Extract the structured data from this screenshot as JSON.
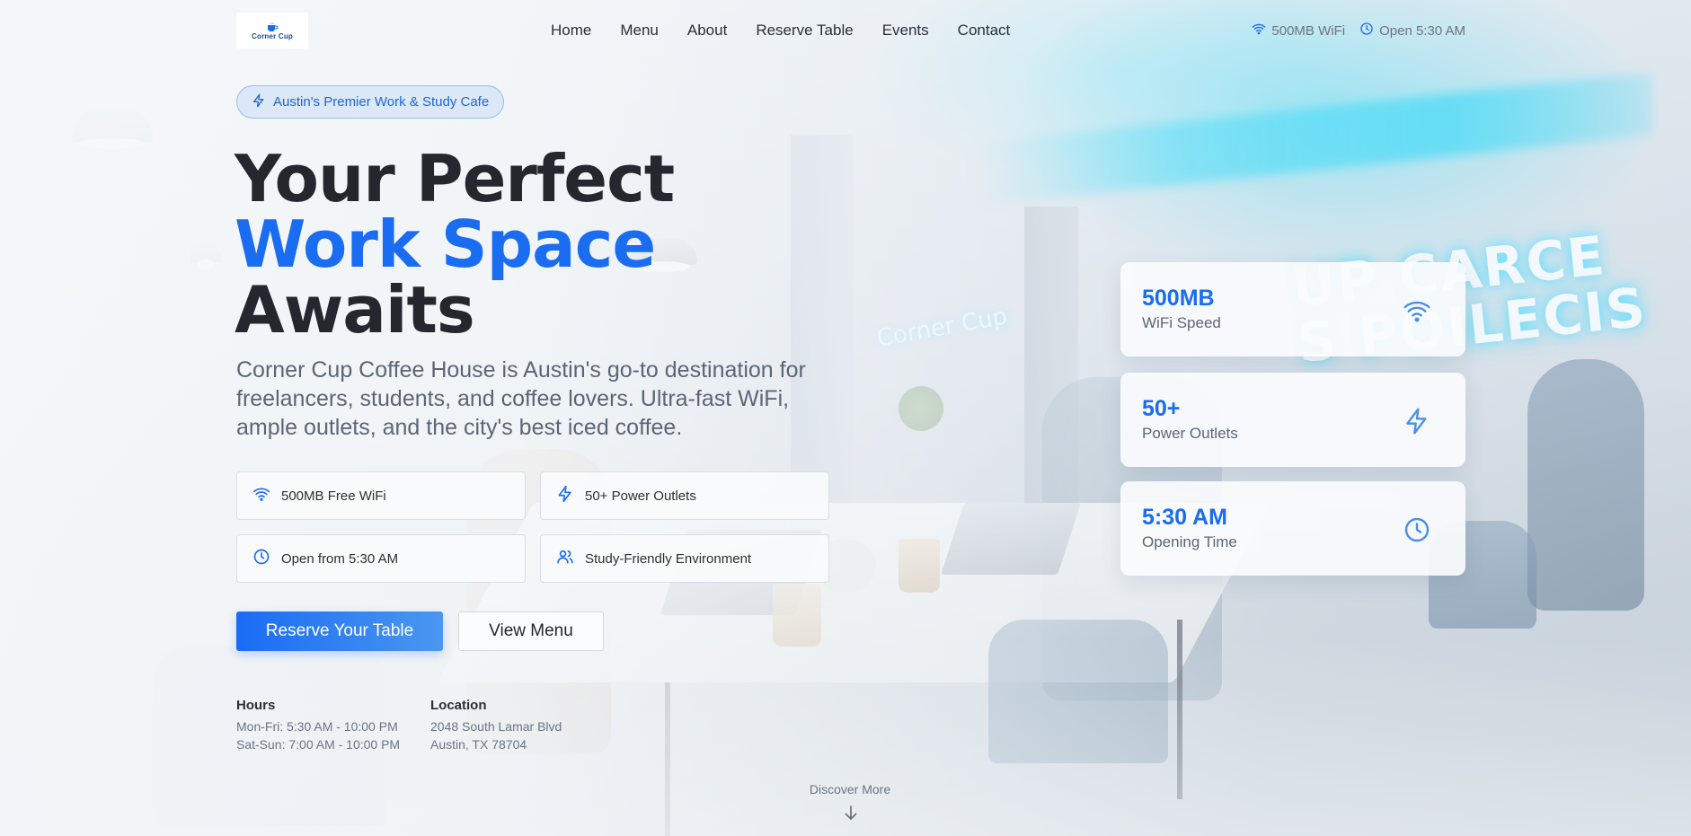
{
  "header": {
    "logo_text": "Corner Cup",
    "nav": [
      {
        "label": "Home"
      },
      {
        "label": "Menu"
      },
      {
        "label": "About"
      },
      {
        "label": "Reserve Table"
      },
      {
        "label": "Events"
      },
      {
        "label": "Contact"
      }
    ],
    "top_info": {
      "wifi": "500MB WiFi",
      "hours": "Open 5:30 AM"
    }
  },
  "hero": {
    "badge": "Austin's Premier Work & Study Cafe",
    "title_line1": "Your Perfect",
    "title_line2": "Work Space",
    "title_line3": "Awaits",
    "lead": "Corner Cup Coffee House is Austin's go-to destination for freelancers, students, and coffee lovers. Ultra-fast WiFi, ample outlets, and the city's best iced coffee.",
    "features": [
      {
        "label": "500MB Free WiFi",
        "icon": "wifi-icon"
      },
      {
        "label": "50+ Power Outlets",
        "icon": "bolt-icon"
      },
      {
        "label": "Open from 5:30 AM",
        "icon": "clock-icon"
      },
      {
        "label": "Study-Friendly Environment",
        "icon": "users-icon"
      }
    ],
    "primary_cta": "Reserve Your Table",
    "secondary_cta": "View Menu",
    "hours": {
      "heading": "Hours",
      "weekdays": "Mon-Fri: 5:30 AM - 10:00 PM",
      "weekends": "Sat-Sun: 7:00 AM - 10:00 PM"
    },
    "location": {
      "heading": "Location",
      "street": "2048 South Lamar Blvd",
      "city": "Austin, TX 78704"
    },
    "discover": "Discover More"
  },
  "stats": [
    {
      "value": "500MB",
      "label": "WiFi Speed",
      "icon": "wifi-icon"
    },
    {
      "value": "50+",
      "label": "Power Outlets",
      "icon": "bolt-icon"
    },
    {
      "value": "5:30 AM",
      "label": "Opening Time",
      "icon": "clock-icon"
    }
  ],
  "colors": {
    "accent": "#1a6cf0",
    "text_dark": "#24272e",
    "text_muted": "#5b6675"
  }
}
